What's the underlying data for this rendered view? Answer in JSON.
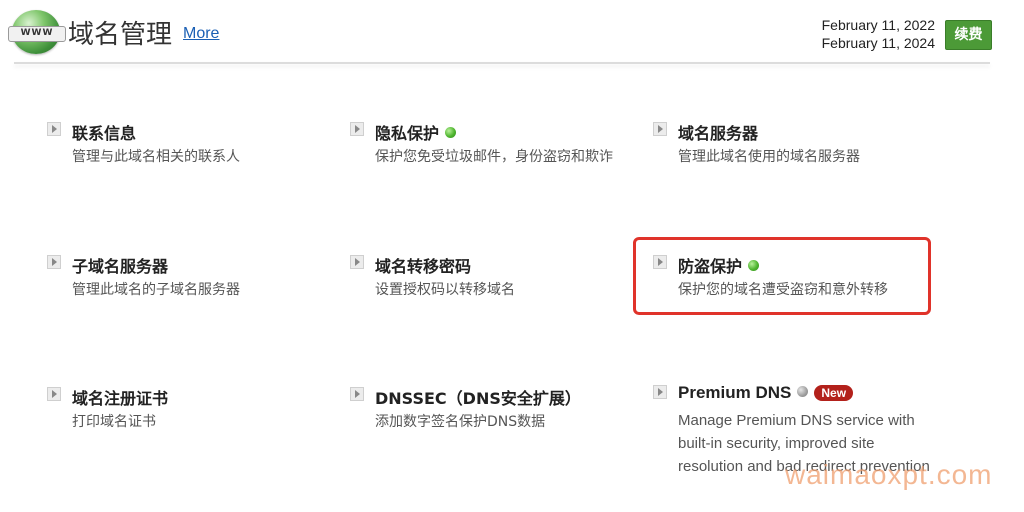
{
  "header": {
    "globe_label": "WWW",
    "title": "域名管理",
    "more_link": "More",
    "date_1": "February 11, 2022",
    "date_2": "February 11, 2024",
    "renew_button": "续费"
  },
  "items": [
    {
      "title": "联系信息",
      "desc": "管理与此域名相关的联系人"
    },
    {
      "title": "隐私保护",
      "desc": "保护您免受垃圾邮件，身份盗窃和欺诈",
      "status": "on"
    },
    {
      "title": "域名服务器",
      "desc": "管理此域名使用的域名服务器"
    },
    {
      "title": "子域名服务器",
      "desc": "管理此域名的子域名服务器"
    },
    {
      "title": "域名转移密码",
      "desc": "设置授权码以转移域名"
    },
    {
      "title": "防盗保护",
      "desc": "保护您的域名遭受盗窃和意外转移",
      "status": "on",
      "highlighted": true
    },
    {
      "title": "域名注册证书",
      "desc": "打印域名证书"
    },
    {
      "title": "DNSSEC（DNS安全扩展）",
      "desc": "添加数字签名保护DNS数据"
    },
    {
      "title": "Premium DNS",
      "desc": "Manage Premium DNS service with built-in security, improved site resolution and bad redirect prevention",
      "status": "off",
      "badge": "New"
    }
  ],
  "colors": {
    "accent_green": "#4c9a37",
    "highlight_red": "#e0332a",
    "badge_red": "#b3211b",
    "link_blue": "#1a5fb4"
  },
  "watermark": "waimaoxpt.com"
}
